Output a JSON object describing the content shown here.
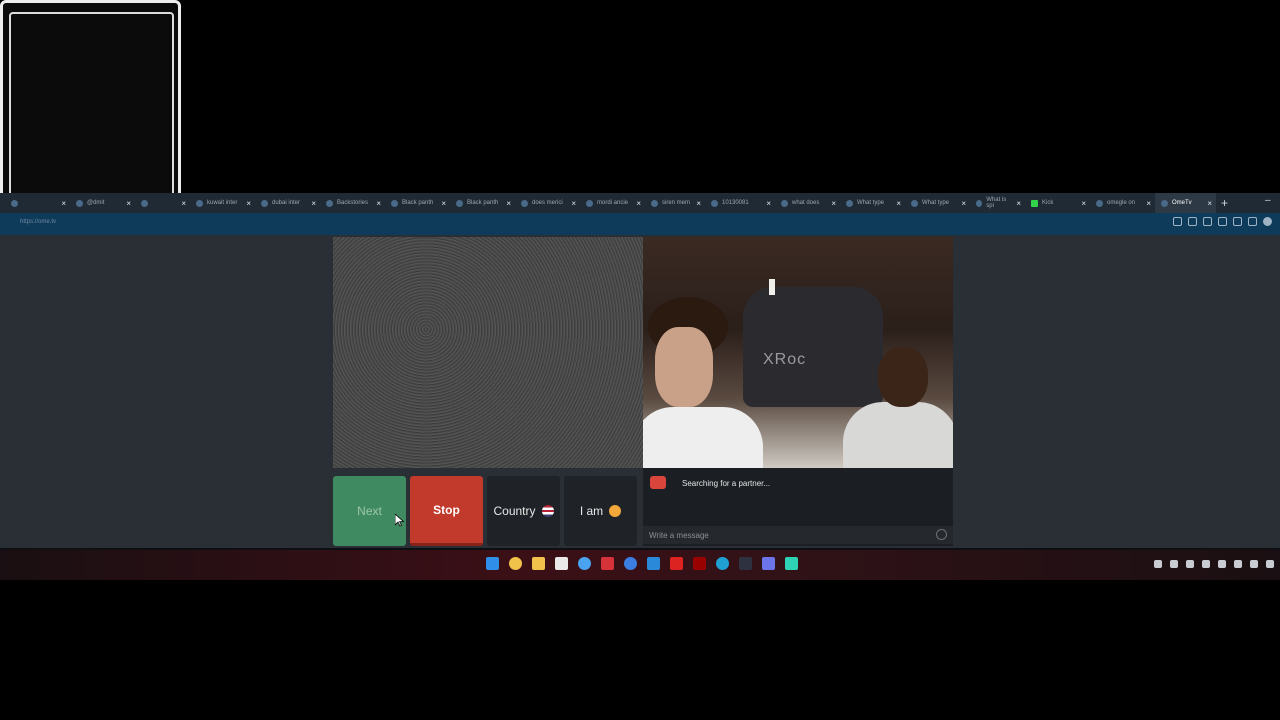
{
  "browser": {
    "tabs": [
      {
        "label": "",
        "active": false
      },
      {
        "label": "@dmit",
        "active": false
      },
      {
        "label": "",
        "active": false
      },
      {
        "label": "kuwait inter",
        "active": false
      },
      {
        "label": "dubai inter",
        "active": false
      },
      {
        "label": "Backstories",
        "active": false
      },
      {
        "label": "Black panth",
        "active": false
      },
      {
        "label": "Black panth",
        "active": false
      },
      {
        "label": "does merici",
        "active": false
      },
      {
        "label": "mordi ancie",
        "active": false
      },
      {
        "label": "siren mem",
        "active": false
      },
      {
        "label": "10130081",
        "active": false
      },
      {
        "label": "what does",
        "active": false
      },
      {
        "label": "What type",
        "active": false
      },
      {
        "label": "What type",
        "active": false
      },
      {
        "label": "What is spi",
        "active": false
      },
      {
        "label": "Kick",
        "active": false
      },
      {
        "label": "omegle on",
        "active": false
      },
      {
        "label": "OmeTv",
        "active": true
      }
    ],
    "new_tab_symbol": "+",
    "minimize_symbol": "–",
    "url": "https://ome.tv"
  },
  "controls": {
    "next_label": "Next",
    "stop_label": "Stop",
    "country_label": "Country",
    "iam_label": "I am"
  },
  "chat": {
    "status": "Searching for a partner...",
    "message_placeholder": "Write a message"
  },
  "partner_video": {
    "chair_logo": "XRoc"
  },
  "colors": {
    "next": "#3f8a60",
    "stop": "#c23a2c",
    "page_bg": "#2a2f35"
  }
}
